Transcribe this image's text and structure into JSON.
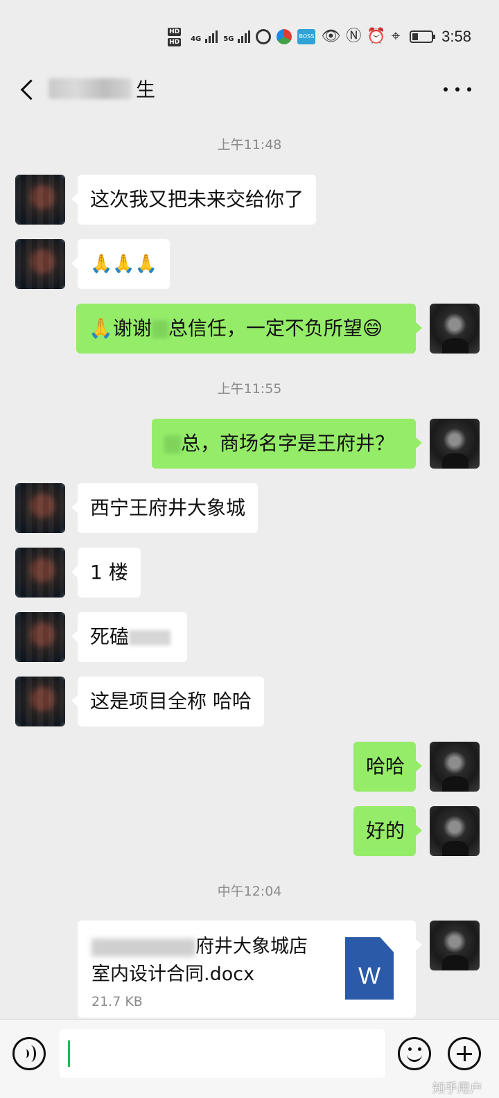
{
  "status_bar": {
    "hd_labels": [
      "HD",
      "HD"
    ],
    "network_1": "4G",
    "network_2": "5G",
    "boss_app": "BOSS",
    "time": "3:58",
    "battery_level": 0.3
  },
  "header": {
    "title_suffix": "生",
    "more": "···"
  },
  "messages": {
    "t1": "上午11:48",
    "m1": "这次我又把未来交给你了",
    "m2": "🙏🙏🙏",
    "m3_prefix": "🙏谢谢",
    "m3_rest": "总信任，一定不负所望",
    "m3_emoji": "😄",
    "t2": "上午11:55",
    "m4": "总，商场名字是王府井？",
    "m5": "西宁王府井大象城",
    "m6": "1 楼",
    "m7": "死磕",
    "m8": "这是项目全称 哈哈",
    "m9": "哈哈",
    "m10": "好的",
    "t3": "中午12:04"
  },
  "file": {
    "name_line1_visible": "府井大象城店",
    "name_line2": "室内设计合同.docx",
    "size": "21.7 KB",
    "icon_letter": "W"
  },
  "input": {
    "value": ""
  },
  "watermark": "知乎用户"
}
